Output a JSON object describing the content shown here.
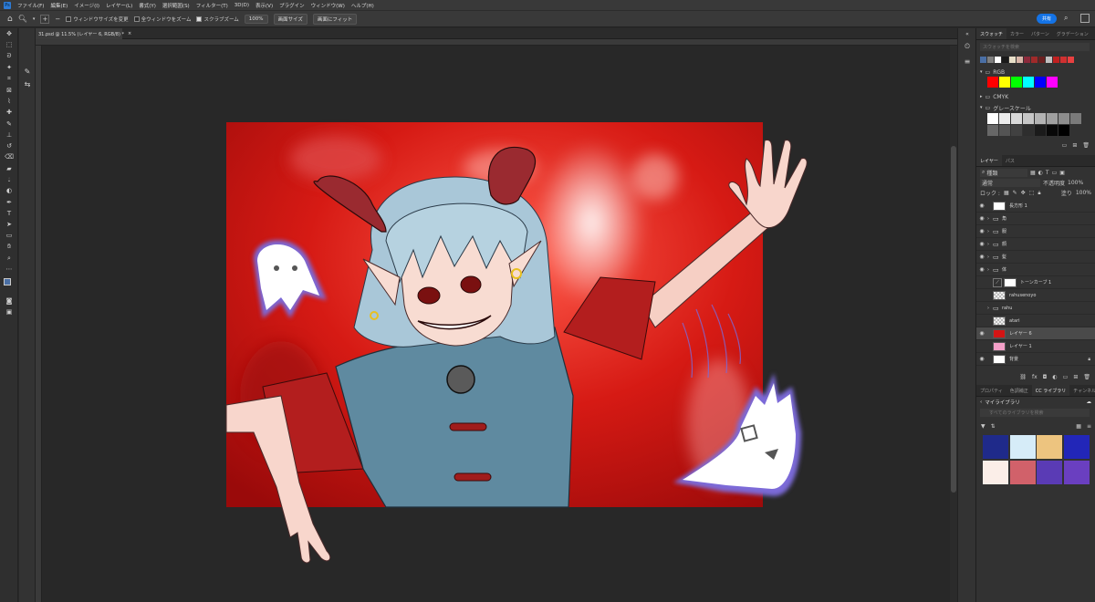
{
  "app": {
    "logo": "Ps"
  },
  "menu": [
    "ファイル(F)",
    "編集(E)",
    "イメージ(I)",
    "レイヤー(L)",
    "書式(Y)",
    "選択範囲(S)",
    "フィルター(T)",
    "3D(D)",
    "表示(V)",
    "プラグイン",
    "ウィンドウ(W)",
    "ヘルプ(H)"
  ],
  "options": {
    "resize_windows": "ウィンドウサイズを変更",
    "all_windows": "全ウィンドウをズーム",
    "scrubby_zoom": "スクラブズーム",
    "zoom_value": "100%",
    "fit_screen": "画面サイズ",
    "fill_screen": "画面にフィット",
    "share": "共有"
  },
  "document_tab": {
    "title": "31.psd @ 11.5% (レイヤー 6, RGB/8) *",
    "close": "×"
  },
  "swatches": {
    "tabs": [
      "スウォッチ",
      "カラー",
      "パターン",
      "グラデーション"
    ],
    "search_placeholder": "スウォッチを検索",
    "recent": [
      "#4a6fa5",
      "#7f7f7f",
      "#ffffff",
      "#1a1a1a",
      "#e8dfc8",
      "#d9b6a8",
      "#8c2a3b",
      "#a02a2a",
      "#6b2020",
      "#c0c0c0",
      "#c02020",
      "#d03030",
      "#e84040"
    ],
    "groups": [
      {
        "name": "RGB",
        "colors": [
          "#ff0000",
          "#ffff00",
          "#00ff00",
          "#00ffff",
          "#0000ff",
          "#ff00ff"
        ]
      },
      {
        "name": "CMYK"
      },
      {
        "name": "グレースケール",
        "colors": [
          "#ffffff",
          "#ececec",
          "#d9d9d9",
          "#c6c6c6",
          "#b3b3b3",
          "#a0a0a0",
          "#8d8d8d",
          "#7a7a7a",
          "#676767",
          "#545454",
          "#414141",
          "#2e2e2e",
          "#1b1b1b",
          "#080808",
          "#000000"
        ]
      }
    ]
  },
  "layers": {
    "tabs": [
      "レイヤー",
      "パス"
    ],
    "kind_label": "種類",
    "blend_mode": "通常",
    "opacity_label": "不透明度",
    "opacity_value": "100%",
    "lock_label": "ロック :",
    "fill_label": "塗り",
    "fill_value": "100%",
    "items": [
      {
        "name": "長方形 1",
        "visible": true,
        "type": "shape"
      },
      {
        "name": "角",
        "visible": true,
        "type": "folder"
      },
      {
        "name": "服",
        "visible": true,
        "type": "folder"
      },
      {
        "name": "顔",
        "visible": true,
        "type": "folder"
      },
      {
        "name": "髪",
        "visible": true,
        "type": "folder"
      },
      {
        "name": "体",
        "visible": true,
        "type": "folder"
      },
      {
        "name": "トーンカーブ 1",
        "visible": false,
        "type": "adjustment"
      },
      {
        "name": "rahusenoyo",
        "visible": false,
        "type": "pixel"
      },
      {
        "name": "rahu",
        "visible": false,
        "type": "folder"
      },
      {
        "name": "atari",
        "visible": false,
        "type": "pixel"
      },
      {
        "name": "レイヤー 6",
        "visible": true,
        "type": "pixel",
        "selected": true
      },
      {
        "name": "レイヤー 1",
        "visible": false,
        "type": "pink"
      },
      {
        "name": "背景",
        "visible": true,
        "type": "background"
      }
    ],
    "footer_icons": [
      "link-icon",
      "fx-icon",
      "mask-icon",
      "adjustment-icon",
      "folder-icon",
      "new-layer-icon",
      "trash-icon"
    ]
  },
  "library": {
    "tabs": [
      "プロパティ",
      "色調補正",
      "CC ライブラリ",
      "チャンネル"
    ],
    "title": "マイライブラリ",
    "search_placeholder": "すべてのライブラリを検索",
    "colors": [
      "#1f2a8a",
      "#d6ecf8",
      "#edc47f",
      "#2226b8",
      "#fbeee8",
      "#d1616a",
      "#5a3bb5",
      "#6a3fc0"
    ]
  },
  "colors": {
    "accent": "#1473e6",
    "art_red": "#d41414",
    "hair": "#a9c7d8",
    "vest": "#5f8aa0",
    "sleeve": "#b31e1e",
    "horn": "#9a2a30",
    "ghost_glow": "#7b6ad8"
  }
}
